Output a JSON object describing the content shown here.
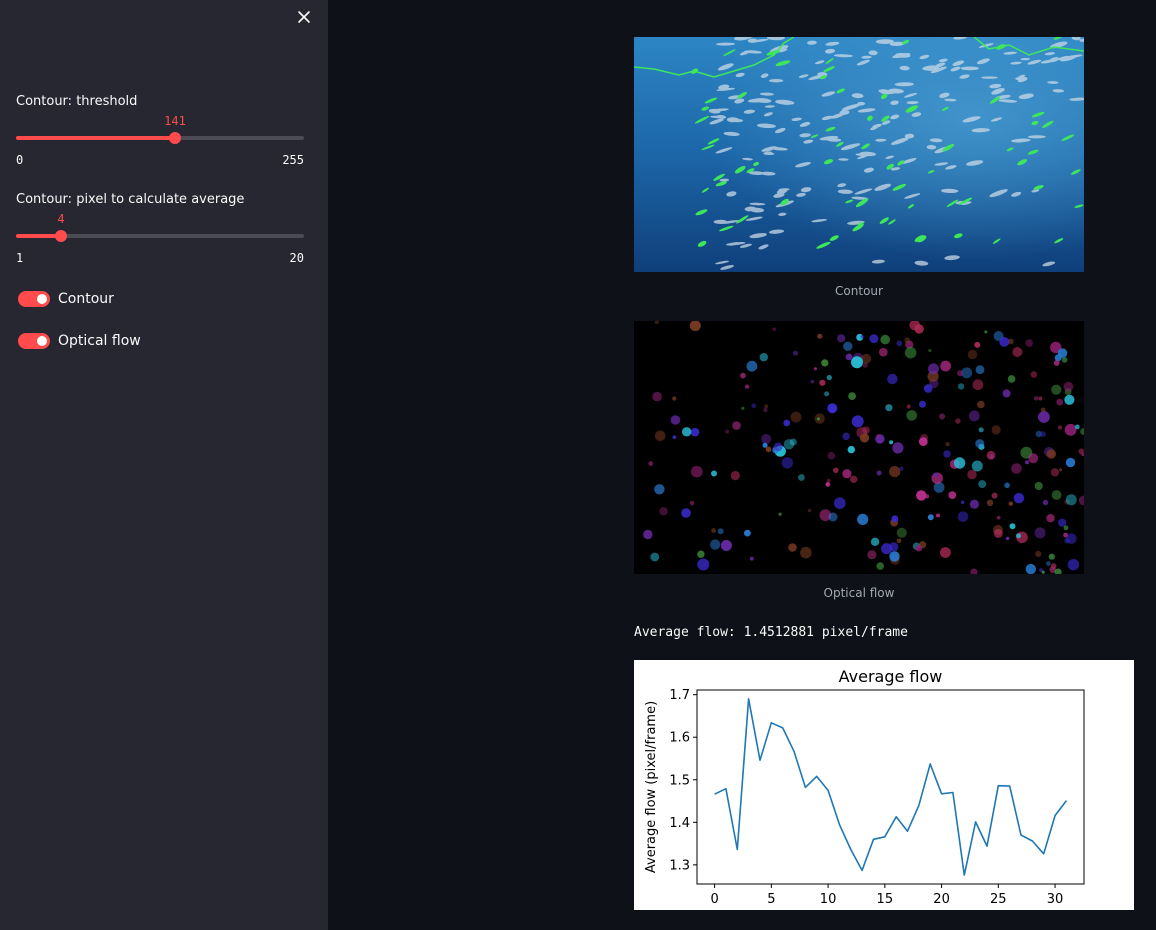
{
  "colors": {
    "accent": "#ff4b4b",
    "sidebar_bg": "#262730",
    "main_bg": "#0e1117",
    "caption": "#a3a8b4",
    "line": "#1f77b4"
  },
  "sidebar": {
    "close_icon": "close-icon",
    "sliders": [
      {
        "label": "Contour: threshold",
        "value": "141",
        "min": "0",
        "max": "255",
        "fraction": 0.553
      },
      {
        "label": "Contour: pixel to calculate average",
        "value": "4",
        "min": "1",
        "max": "20",
        "fraction": 0.158
      }
    ],
    "toggles": [
      {
        "label": "Contour",
        "on": true
      },
      {
        "label": "Optical flow",
        "on": true
      }
    ]
  },
  "main": {
    "images": [
      {
        "caption": "Contour",
        "icon": "contour-fish-image"
      },
      {
        "caption": "Optical flow",
        "icon": "optical-flow-image"
      }
    ],
    "average_flow_text": "Average flow: 1.4512881 pixel/frame"
  },
  "chart_data": {
    "type": "line",
    "title": "Average flow",
    "xlabel": "",
    "ylabel": "Average flow (pixel/frame)",
    "x": [
      0,
      1,
      2,
      3,
      4,
      5,
      6,
      7,
      8,
      9,
      10,
      11,
      12,
      13,
      14,
      15,
      16,
      17,
      18,
      19,
      20,
      21,
      22,
      23,
      24,
      25,
      26,
      27,
      28,
      29,
      30,
      31
    ],
    "series": [
      {
        "values": [
          1.466,
          1.479,
          1.336,
          1.69,
          1.546,
          1.634,
          1.622,
          1.567,
          1.482,
          1.508,
          1.475,
          1.395,
          1.336,
          1.287,
          1.36,
          1.366,
          1.413,
          1.379,
          1.44,
          1.537,
          1.467,
          1.47,
          1.276,
          1.401,
          1.344,
          1.486,
          1.485,
          1.37,
          1.356,
          1.326,
          1.416,
          1.451
        ]
      }
    ],
    "xlim": [
      -1.55,
      32.55
    ],
    "ylim": [
      1.255,
      1.711
    ],
    "xticks": [
      "0",
      "5",
      "10",
      "15",
      "20",
      "25",
      "30"
    ],
    "xtick_values": [
      0,
      5,
      10,
      15,
      20,
      25,
      30
    ],
    "yticks": [
      "1.3",
      "1.4",
      "1.5",
      "1.6",
      "1.7"
    ],
    "ytick_values": [
      1.3,
      1.4,
      1.5,
      1.6,
      1.7
    ],
    "grid": false,
    "legend": "none"
  }
}
